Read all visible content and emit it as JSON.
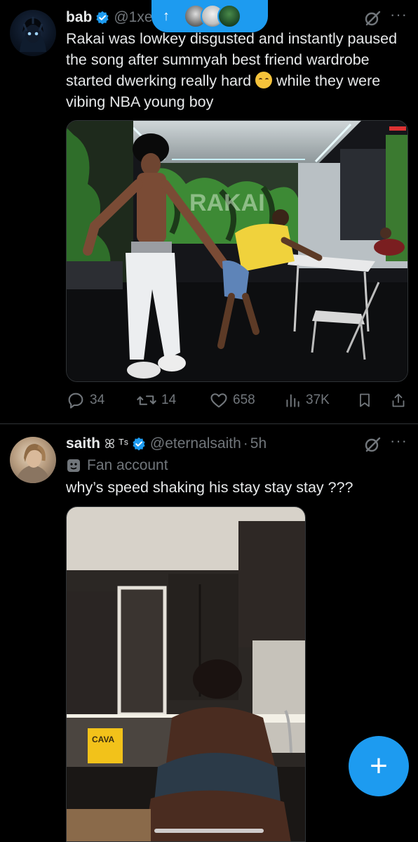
{
  "tweet1": {
    "display_name": "bab",
    "handle": "@1xe",
    "text_a": "Rakai was lowkey disgusted and instantly paused the song after summyah best friend wardrobe started dwerking really hard ",
    "text_b": " while they were vibing NBA young boy",
    "emoji": "loudly-crying-face-emoji",
    "media_sign_text": "RAKAI",
    "replies": "34",
    "reposts": "14",
    "likes": "658",
    "views": "37K"
  },
  "tweet2": {
    "display_name": "saith",
    "badges": "ꕤ ᵀˢ",
    "handle": "@eternalsaith",
    "separator": "·",
    "time": "5h",
    "label": "Fan account",
    "text": "why’s speed shaking his stay stay stay ???",
    "media_sign_text": "CAVA"
  },
  "new_posts_pill": {
    "arrow": "↑"
  },
  "fab": {
    "label": "+"
  },
  "colors": {
    "accent": "#1d9bf0",
    "muted": "#71767b",
    "text": "#e7e9ea",
    "divider": "#2f3336"
  }
}
